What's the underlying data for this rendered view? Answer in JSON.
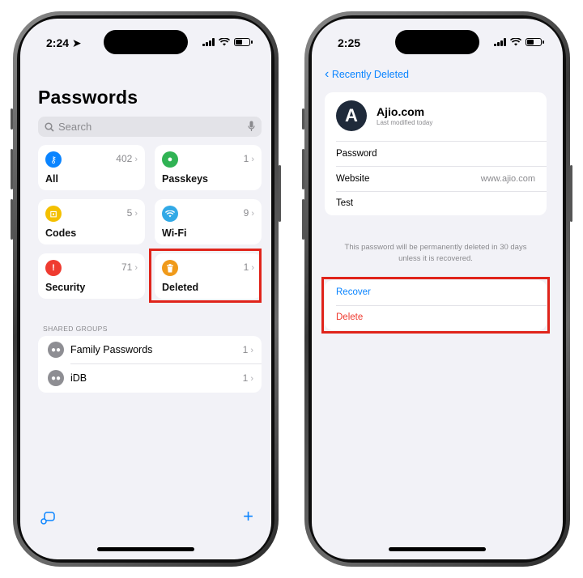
{
  "left_phone": {
    "status": {
      "time": "2:24"
    },
    "title": "Passwords",
    "search": {
      "placeholder": "Search"
    },
    "tiles": [
      {
        "label": "All",
        "count": "402",
        "icon": "key-icon",
        "color": "#0a84ff"
      },
      {
        "label": "Passkeys",
        "count": "1",
        "icon": "person-icon",
        "color": "#30b354"
      },
      {
        "label": "Codes",
        "count": "5",
        "icon": "lock-icon",
        "color": "#f4c000"
      },
      {
        "label": "Wi-Fi",
        "count": "9",
        "icon": "wifi-icon",
        "color": "#32a9e6"
      },
      {
        "label": "Security",
        "count": "71",
        "icon": "exclamation-icon",
        "color": "#ef3b30"
      },
      {
        "label": "Deleted",
        "count": "1",
        "icon": "trash-icon",
        "color": "#f09a1a"
      }
    ],
    "shared_groups_header": "SHARED GROUPS",
    "groups": [
      {
        "label": "Family Passwords",
        "count": "1"
      },
      {
        "label": "iDB",
        "count": "1"
      }
    ]
  },
  "right_phone": {
    "status": {
      "time": "2:25"
    },
    "back_label": "Recently Deleted",
    "site_name": "Ajio.com",
    "modified": "Last modified today",
    "fields": [
      {
        "label": "Password",
        "value": ""
      },
      {
        "label": "Website",
        "value": "www.ajio.com"
      },
      {
        "label": "Test",
        "value": ""
      }
    ],
    "note": "This password will be permanently deleted in 30 days unless it is recovered.",
    "recover_label": "Recover",
    "delete_label": "Delete"
  },
  "colors": {
    "accent": "#0a84ff",
    "destructive": "#ef3b30",
    "highlight": "#e0241b"
  }
}
